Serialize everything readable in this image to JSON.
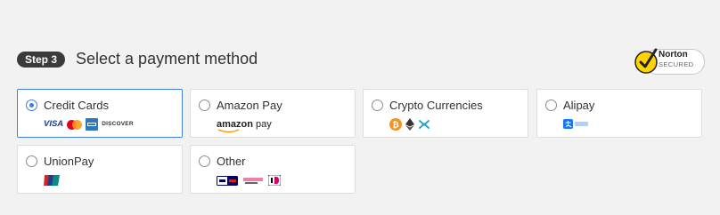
{
  "header": {
    "step_label": "Step 3",
    "title": "Select a payment method"
  },
  "badge": {
    "brand": "Norton",
    "sub": "SECURED",
    "icon": "norton-check-icon"
  },
  "colors": {
    "accent": "#3d7fdc",
    "badge_bg": "#3a3a3a"
  },
  "methods": [
    {
      "label": "Credit Cards",
      "selected": true,
      "logos": [
        "VISA",
        "mastercard-icon",
        "amex-icon",
        "DISCOVER"
      ]
    },
    {
      "label": "Amazon Pay",
      "selected": false,
      "logos": [
        "amazon",
        "pay"
      ]
    },
    {
      "label": "Crypto Currencies",
      "selected": false,
      "logos": [
        "bitcoin-icon",
        "ethereum-icon",
        "ripple-icon"
      ]
    },
    {
      "label": "Alipay",
      "selected": false,
      "logos": [
        "alipay-icon"
      ]
    },
    {
      "label": "UnionPay",
      "selected": false,
      "logos": [
        "unionpay-icon"
      ]
    },
    {
      "label": "Other",
      "selected": false,
      "logos": [
        "giropay-icon",
        "sofort-icon",
        "ideal-icon"
      ]
    }
  ]
}
